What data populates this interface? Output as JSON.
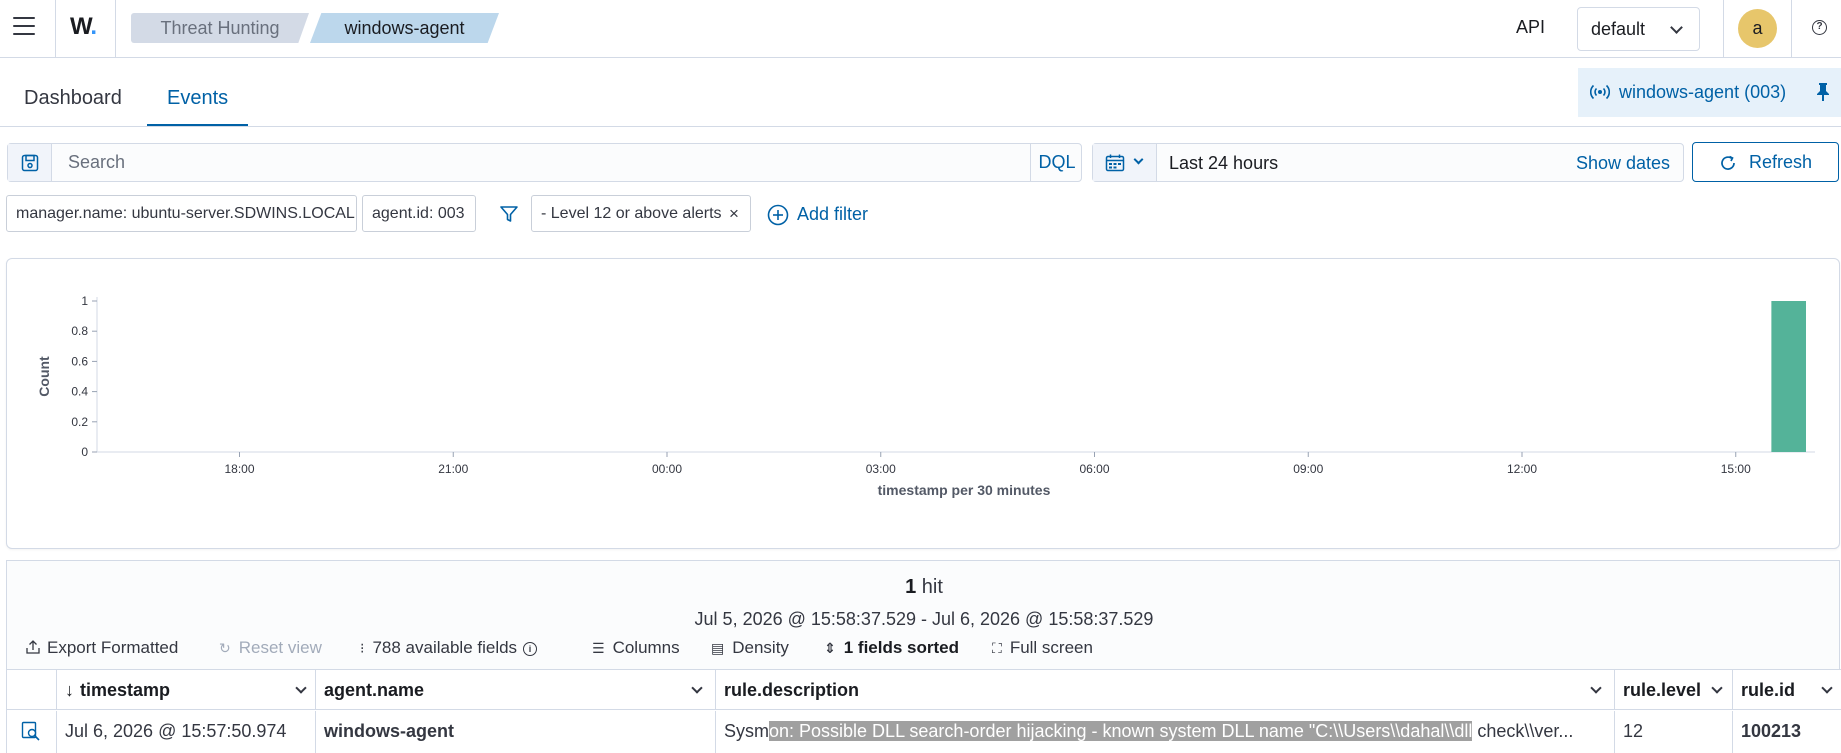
{
  "header": {
    "logo": "W",
    "breadcrumbs": [
      "Threat Hunting",
      "windows-agent"
    ],
    "api_label": "API",
    "server_select": "default",
    "avatar_letter": "a",
    "help": "?"
  },
  "tabs": [
    {
      "label": "Dashboard",
      "active": false
    },
    {
      "label": "Events",
      "active": true
    }
  ],
  "pinned_agent": "windows-agent (003)",
  "search": {
    "placeholder": "Search",
    "value": "",
    "language": "DQL"
  },
  "datepicker": {
    "value": "Last 24 hours",
    "show_dates": "Show dates",
    "refresh": "Refresh"
  },
  "filters": [
    "manager.name: ubuntu-server.SDWINS.LOCAL",
    "agent.id: 003",
    "- Level 12 or above alerts"
  ],
  "filter_remove": "×",
  "add_filter": "Add filter",
  "chart_data": {
    "type": "bar",
    "ylabel": "Count",
    "xlabel": "timestamp per 30 minutes",
    "ylim": [
      0,
      1
    ],
    "yticks": [
      "0",
      "0.2",
      "0.4",
      "0.6",
      "0.8",
      "1"
    ],
    "xticks": [
      "18:00",
      "21:00",
      "00:00",
      "03:00",
      "06:00",
      "09:00",
      "12:00",
      "15:00"
    ],
    "x": [
      "15:30"
    ],
    "values": [
      1
    ],
    "color": "#54b399",
    "grid": false
  },
  "results": {
    "hits_count": "1",
    "hits_label": "hit",
    "range": "Jul 5, 2026 @ 15:58:37.529 - Jul 6, 2026 @ 15:58:37.529",
    "toolbar": {
      "export": "Export Formatted",
      "reset": "Reset view",
      "fields": "788 available fields",
      "columns": "Columns",
      "density": "Density",
      "sorted": "1 fields sorted",
      "fullscreen": "Full screen"
    },
    "columns": [
      "timestamp",
      "agent.name",
      "rule.description",
      "rule.level",
      "rule.id"
    ],
    "rows": [
      {
        "timestamp": "Jul 6, 2026 @ 15:57:50.974",
        "agent_name": "windows-agent",
        "desc_pre": "Sysm",
        "desc_hl": "on: Possible DLL search-order hijacking - known system DLL name \"C:\\\\Users\\\\dahal\\\\dll",
        "desc_post": " check\\\\ver...",
        "level": "12",
        "rule_id": "100213"
      }
    ]
  }
}
